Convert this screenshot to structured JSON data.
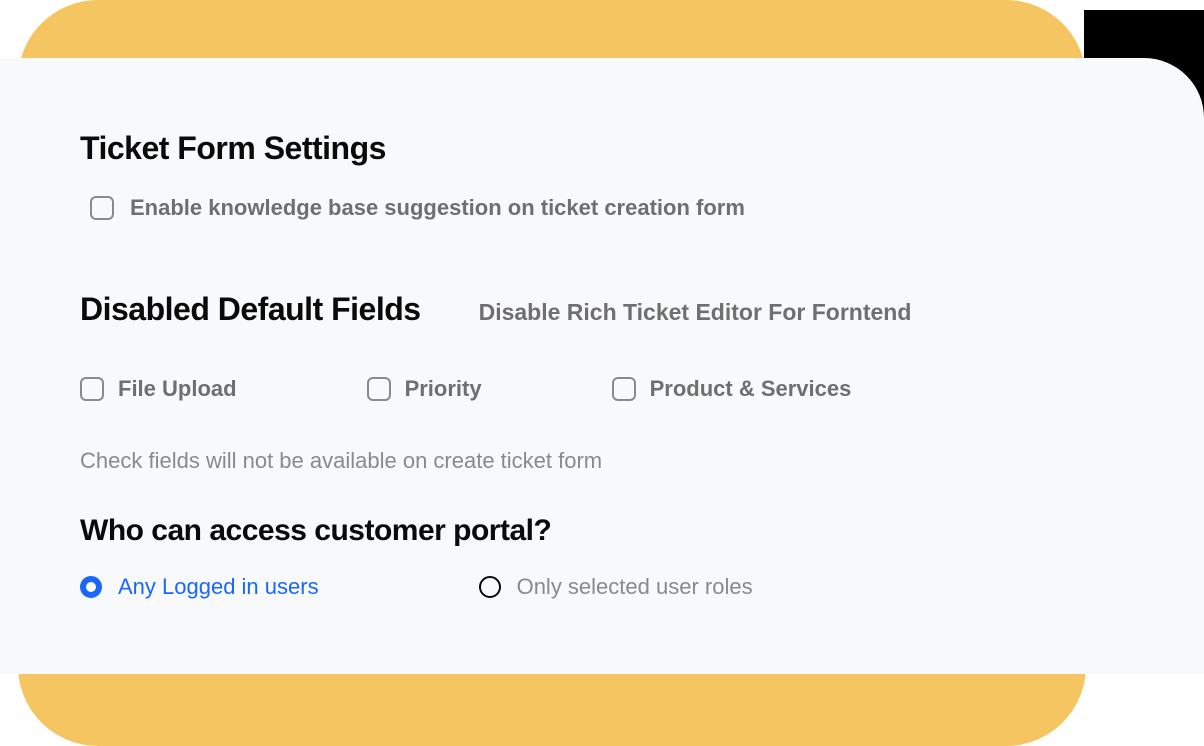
{
  "section1": {
    "title": "Ticket Form Settings",
    "checkbox_label": "Enable knowledge base suggestion on ticket creation form"
  },
  "section2": {
    "title": "Disabled Default Fields",
    "subtitle": "Disable Rich Ticket Editor For Forntend",
    "fields": {
      "file_upload": "File Upload",
      "priority": "Priority",
      "product_services": "Product & Services"
    },
    "helper": "Check fields will not be available on create ticket form"
  },
  "section3": {
    "title": "Who can access customer portal?",
    "option1": "Any Logged in users",
    "option2": "Only selected user roles"
  }
}
